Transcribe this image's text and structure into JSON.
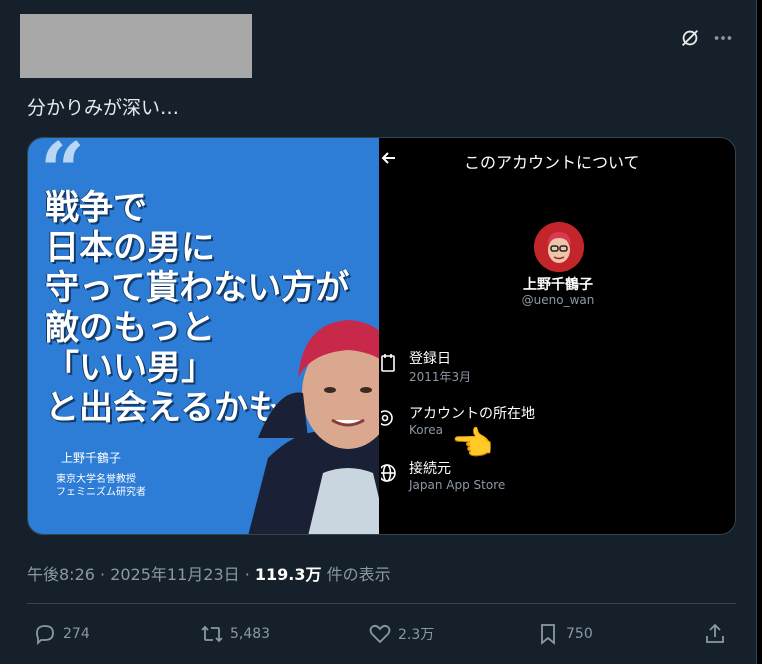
{
  "tweet": {
    "text": "分かりみが深い…",
    "timestamp": "午後8:26 · 2025年11月23日 ·",
    "views_count": "119.3万",
    "views_label": "件の表示"
  },
  "image_left": {
    "quote_glyph": "“",
    "lines": [
      "戦争で",
      "日本の男に",
      "守って貰わない方が",
      "敵のもっと",
      "「いい男」",
      "と出会えるかも"
    ],
    "name": "上野千鶴子",
    "title_line1": "東京大学名誉教授",
    "title_line2": "フェミニズム研究者"
  },
  "image_right": {
    "title": "このアカウントについて",
    "name": "上野千鶴子",
    "handle": "@ueno_wan",
    "rows": [
      {
        "label": "登録日",
        "value": "2011年3月",
        "icon": "calendar-icon"
      },
      {
        "label": "アカウントの所在地",
        "value": "Korea",
        "icon": "location-icon"
      },
      {
        "label": "接続元",
        "value": "Japan App Store",
        "icon": "globe-icon"
      }
    ],
    "emoji": "👈"
  },
  "actions": {
    "replies": "274",
    "retweets": "5,483",
    "likes": "2.3万",
    "bookmarks": "750"
  }
}
